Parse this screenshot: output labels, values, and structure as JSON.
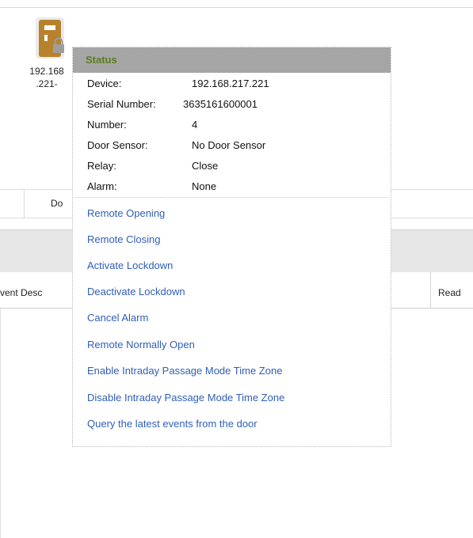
{
  "door": {
    "label_line1": "192.168",
    "label_line2": ".221-",
    "icon": "door-lock-icon",
    "icon_color": "#b8822c"
  },
  "background_table": {
    "grid_column_text": "Do",
    "event_header": "vent Desc",
    "reader_header": "Read"
  },
  "popup": {
    "title": "Status",
    "status": [
      {
        "label": "Device:",
        "value": "192.168.217.221"
      },
      {
        "label": "Serial Number:",
        "value": "3635161600001"
      },
      {
        "label": "Number:",
        "value": "4"
      },
      {
        "label": "Door Sensor:",
        "value": "No Door Sensor"
      },
      {
        "label": "Relay:",
        "value": "Close"
      },
      {
        "label": "Alarm:",
        "value": "None"
      }
    ],
    "actions": [
      "Remote Opening",
      "Remote Closing",
      "Activate Lockdown",
      "Deactivate Lockdown",
      "Cancel Alarm",
      "Remote Normally Open",
      "Enable Intraday Passage Mode Time Zone",
      "Disable Intraday Passage Mode Time Zone",
      "Query the latest events from the door"
    ],
    "title_color": "#5a7e1e",
    "link_color": "#2f5fb7",
    "header_bg": "#a5a5a5"
  }
}
